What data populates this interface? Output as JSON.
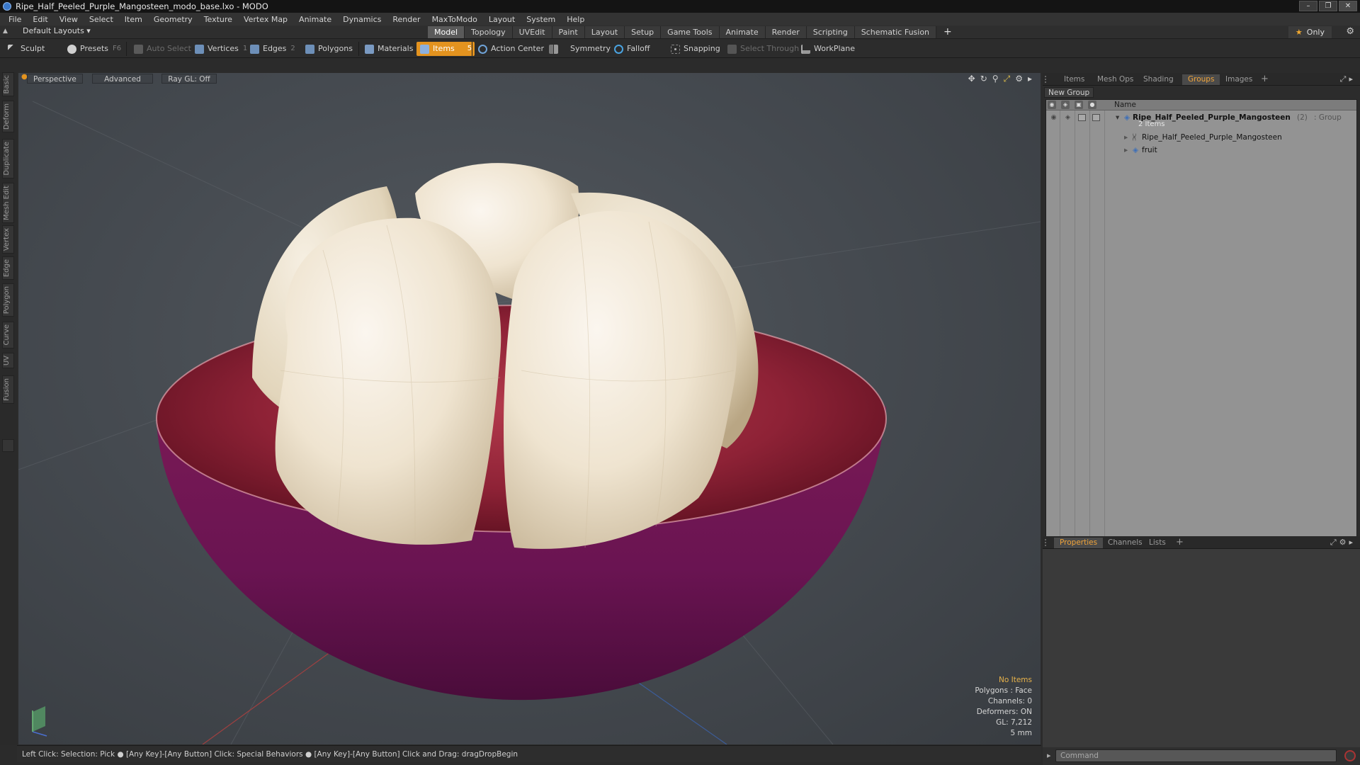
{
  "window": {
    "title": "Ripe_Half_Peeled_Purple_Mangosteen_modo_base.lxo - MODO",
    "controls": [
      "–",
      "❐",
      "✕"
    ]
  },
  "menu": [
    "File",
    "Edit",
    "View",
    "Select",
    "Item",
    "Geometry",
    "Texture",
    "Vertex Map",
    "Animate",
    "Dynamics",
    "Render",
    "MaxToModo",
    "Layout",
    "System",
    "Help"
  ],
  "layout_bar": {
    "layouts_label": "Default Layouts ▾",
    "tabs": [
      "Model",
      "Topology",
      "UVEdit",
      "Paint",
      "Layout",
      "Setup",
      "Game Tools",
      "Animate",
      "Render",
      "Scripting",
      "Schematic Fusion"
    ],
    "active_tab": "Model",
    "plus": "+",
    "only_label": "Only"
  },
  "toolbar": {
    "sculpt": "Sculpt",
    "presets": "Presets",
    "presets_key": "F6",
    "auto_select": "Auto Select",
    "vertices": "Vertices",
    "vertices_key": "1",
    "edges": "Edges",
    "edges_key": "2",
    "polygons": "Polygons",
    "materials": "Materials",
    "items": "Items",
    "items_key": "5",
    "action_center": "Action Center",
    "symmetry": "Symmetry",
    "falloff": "Falloff",
    "snapping": "Snapping",
    "select_through": "Select Through",
    "workplane": "WorkPlane"
  },
  "left_tabs": [
    "Basic",
    "Deform",
    "Duplicate",
    "Mesh Edit",
    "Vertex",
    "Edge",
    "Polygon",
    "Curve",
    "UV",
    "Fusion"
  ],
  "viewport": {
    "view_mode": "Perspective",
    "shading": "Advanced",
    "raygl": "Ray GL: Off",
    "info": {
      "selection": "No Items",
      "polygons": "Polygons : Face",
      "channels": "Channels: 0",
      "deformers": "Deformers: ON",
      "gl": "GL: 7,212",
      "grid": "5 mm"
    }
  },
  "status_bar": "Left Click: Selection: Pick ●  [Any Key]-[Any Button] Click: Special Behaviors ●  [Any Key]-[Any Button] Click and Drag: dragDropBegin",
  "right_panel": {
    "top_tabs": [
      "Items",
      "Mesh Ops",
      "Shading",
      "Groups",
      "Images"
    ],
    "active_top_tab": "Groups",
    "new_group": "New Group",
    "column_name": "Name",
    "groups": {
      "group_name": "Ripe_Half_Peeled_Purple_Mangosteen",
      "group_count": "(2)",
      "group_type": ": Group",
      "group_items": "2 Items",
      "children": [
        "Ripe_Half_Peeled_Purple_Mangosteen",
        "fruit"
      ]
    },
    "bottom_tabs": [
      "Properties",
      "Channels",
      "Lists"
    ],
    "active_bottom_tab": "Properties",
    "command_placeholder": "Command"
  },
  "colors": {
    "accent": "#e3931f",
    "tab_active_text": "#f0a43a",
    "info_highlight": "#e7b24a"
  }
}
